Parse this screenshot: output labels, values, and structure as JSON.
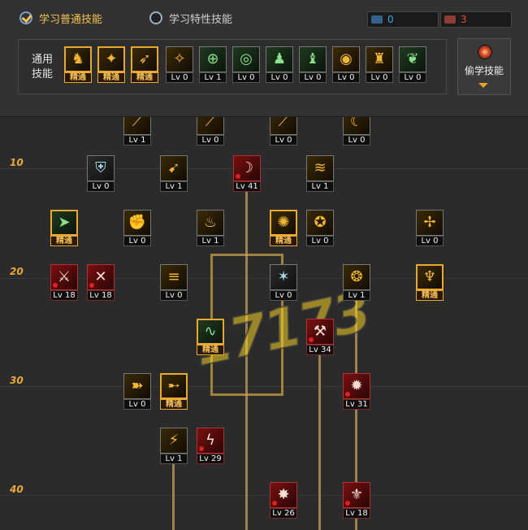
{
  "tabs": [
    {
      "label": "学习普通技能",
      "state": "active"
    },
    {
      "label": "学习特性技能",
      "state": "inactive"
    }
  ],
  "counters": [
    {
      "value": "0",
      "color": "#3aa8e8"
    },
    {
      "value": "3",
      "color": "#e84a3a"
    }
  ],
  "general": {
    "label": "通用技能",
    "skills": [
      {
        "icon": "cross-legged-icon",
        "level": "精通"
      },
      {
        "icon": "leap-icon",
        "level": "精通"
      },
      {
        "icon": "sprint-icon",
        "level": "精通"
      },
      {
        "icon": "wings-icon",
        "level": "Lv 0"
      },
      {
        "icon": "crosshair-icon",
        "level": "Lv 1"
      },
      {
        "icon": "target-icon",
        "level": "Lv 0"
      },
      {
        "icon": "pray-icon",
        "level": "Lv 0"
      },
      {
        "icon": "kneel-icon",
        "level": "Lv 0"
      },
      {
        "icon": "eye-icon",
        "level": "Lv 0"
      },
      {
        "icon": "muscle-icon",
        "level": "Lv 0"
      },
      {
        "icon": "leaf-icon",
        "level": "Lv 0"
      }
    ]
  },
  "steal": {
    "label": "偷学技能"
  },
  "level_markers": [
    "10",
    "20",
    "30",
    "40"
  ],
  "tree_skills": [
    {
      "icon": "slash-icon",
      "level": "Lv 1",
      "style": "yellow"
    },
    {
      "icon": "slash-icon",
      "level": "Lv 0",
      "style": "yellow"
    },
    {
      "icon": "slash-icon",
      "level": "Lv 0",
      "style": "yellow"
    },
    {
      "icon": "moon-icon",
      "level": "Lv 0",
      "style": "yellow"
    },
    {
      "icon": "shield-icon",
      "level": "Lv 0",
      "style": "grey"
    },
    {
      "icon": "run-icon",
      "level": "Lv 1",
      "style": "yellow"
    },
    {
      "icon": "crescent-icon",
      "level": "Lv 41",
      "style": "red"
    },
    {
      "icon": "wind-icon",
      "level": "Lv 1",
      "style": "yellow"
    },
    {
      "icon": "dash-icon",
      "level": "精通",
      "style": "green"
    },
    {
      "icon": "fist-icon",
      "level": "Lv 0",
      "style": "yellow"
    },
    {
      "icon": "flame-icon",
      "level": "Lv 1",
      "style": "yellow"
    },
    {
      "icon": "burst-icon",
      "level": "精通",
      "style": "yellow"
    },
    {
      "icon": "spin-icon",
      "level": "Lv 0",
      "style": "yellow"
    },
    {
      "icon": "thorn-icon",
      "level": "Lv 0",
      "style": "yellow"
    },
    {
      "icon": "cross-swords-icon",
      "level": "Lv 18",
      "style": "red"
    },
    {
      "icon": "swords-icon",
      "level": "Lv 18",
      "style": "red"
    },
    {
      "icon": "multi-strike-icon",
      "level": "Lv 0",
      "style": "yellow"
    },
    {
      "icon": "claw-icon",
      "level": "Lv 0",
      "style": "grey"
    },
    {
      "icon": "vortex-icon",
      "level": "Lv 1",
      "style": "yellow"
    },
    {
      "icon": "fire-pillar-icon",
      "level": "精通",
      "style": "yellow"
    },
    {
      "icon": "wave-icon",
      "level": "精通",
      "style": "green"
    },
    {
      "icon": "axe-icon",
      "level": "Lv 34",
      "style": "red"
    },
    {
      "icon": "kick-icon",
      "level": "Lv 0",
      "style": "yellow"
    },
    {
      "icon": "runner-icon",
      "level": "精通",
      "style": "yellow"
    },
    {
      "icon": "whirl-icon",
      "level": "Lv 31",
      "style": "red"
    },
    {
      "icon": "blade-icon",
      "level": "Lv 1",
      "style": "yellow"
    },
    {
      "icon": "lightning-icon",
      "level": "Lv 29",
      "style": "red"
    },
    {
      "icon": "explosion-icon",
      "level": "Lv 26",
      "style": "red"
    },
    {
      "icon": "dragon-icon",
      "level": "Lv 18",
      "style": "red"
    }
  ],
  "watermark": "17173"
}
